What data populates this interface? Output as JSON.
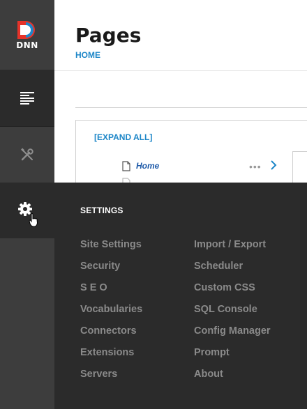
{
  "brand": {
    "logo_text": "DNN"
  },
  "persona_bar": {
    "items": [
      {
        "name": "content",
        "icon": "content-list-icon"
      },
      {
        "name": "manage",
        "icon": "tools-icon"
      },
      {
        "name": "settings",
        "icon": "gear-icon"
      }
    ]
  },
  "header": {
    "title": "Pages",
    "breadcrumb": "HOME"
  },
  "tree": {
    "expand_all": "[EXPAND ALL]",
    "rows": [
      {
        "label": "Home"
      }
    ]
  },
  "flyout": {
    "title": "SETTINGS",
    "left_items": [
      "Site Settings",
      "Security",
      "S E O",
      "Vocabularies",
      "Connectors",
      "Extensions",
      "Servers"
    ],
    "right_items": [
      "Import / Export",
      "Scheduler",
      "Custom CSS",
      "SQL Console",
      "Config Manager",
      "Prompt",
      "About"
    ]
  },
  "colors": {
    "accent": "#1e87c8",
    "persona_bg": "#3d3d3d",
    "flyout_bg": "#2b2b2b",
    "menu_text": "#8a8a8a",
    "logo_red": "#e5332a",
    "logo_blue": "#1e87c8"
  }
}
